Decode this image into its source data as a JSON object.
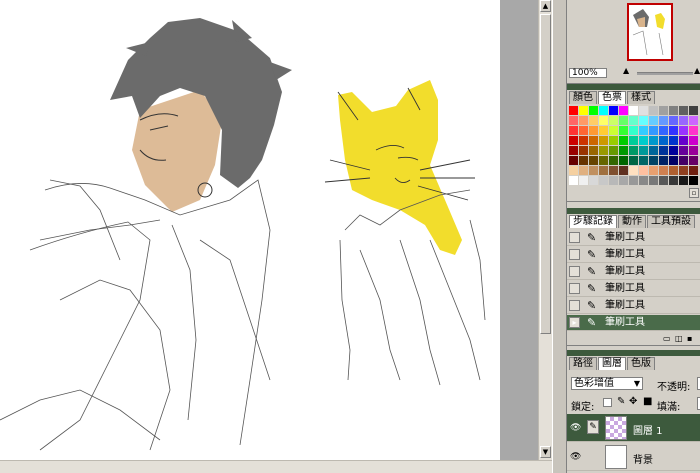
{
  "navigator": {
    "zoom": "100%"
  },
  "swatches_tabs": [
    {
      "label": "顏色",
      "active": false
    },
    {
      "label": "色票",
      "active": true
    },
    {
      "label": "樣式",
      "active": false
    }
  ],
  "history_tabs": [
    {
      "label": "步驟記錄",
      "active": true
    },
    {
      "label": "動作",
      "active": false
    },
    {
      "label": "工具預設",
      "active": false
    }
  ],
  "history": {
    "items": [
      {
        "label": "筆刷工具",
        "icon": "brush-icon",
        "active": false
      },
      {
        "label": "筆刷工具",
        "icon": "brush-icon",
        "active": false
      },
      {
        "label": "筆刷工具",
        "icon": "brush-icon",
        "active": false
      },
      {
        "label": "筆刷工具",
        "icon": "brush-icon",
        "active": false
      },
      {
        "label": "筆刷工具",
        "icon": "brush-icon",
        "active": false
      },
      {
        "label": "筆刷工具",
        "icon": "brush-icon",
        "active": true
      }
    ]
  },
  "layers_tabs": [
    {
      "label": "路徑",
      "active": false
    },
    {
      "label": "圖層",
      "active": true
    },
    {
      "label": "色版",
      "active": false
    }
  ],
  "layers": {
    "blend_mode": "色彩增值",
    "opacity_label": "不透明:",
    "lock_label": "鎖定:",
    "fill_label": "填滿:",
    "items": [
      {
        "name": "圖層 1",
        "active": true
      },
      {
        "name": "背景",
        "active": false
      }
    ]
  },
  "colors": {
    "panel_bg": "#d4d0c8",
    "title_green": "#3d5a3d",
    "active_row": "#4a6b4a",
    "hair_gray": "#6b6b6b",
    "skin": "#d9b48c",
    "cat_yellow": "#f2dd2c"
  },
  "swatch_colors": [
    "#ff0000",
    "#ffff00",
    "#00ff00",
    "#00ffff",
    "#0000ff",
    "#ff00ff",
    "#ffffff",
    "#e0e0e0",
    "#c0c0c0",
    "#a0a0a0",
    "#808080",
    "#606060",
    "#404040",
    "#ff6666",
    "#ff9966",
    "#ffcc66",
    "#ffff66",
    "#ccff66",
    "#66ff66",
    "#66ffcc",
    "#66ffff",
    "#66ccff",
    "#6699ff",
    "#6666ff",
    "#9966ff",
    "#cc66ff",
    "#ff3333",
    "#ff6633",
    "#ff9933",
    "#ffcc33",
    "#ccff33",
    "#33ff33",
    "#33ffcc",
    "#33ccff",
    "#3399ff",
    "#3366ff",
    "#3333ff",
    "#9933ff",
    "#ff33cc",
    "#cc0000",
    "#cc3300",
    "#cc6600",
    "#cc9900",
    "#99cc00",
    "#00cc00",
    "#00cc99",
    "#00cccc",
    "#0099cc",
    "#0066cc",
    "#0033cc",
    "#6600cc",
    "#cc00cc",
    "#990000",
    "#993300",
    "#996600",
    "#999900",
    "#669900",
    "#009900",
    "#009966",
    "#009999",
    "#006699",
    "#003399",
    "#000099",
    "#660099",
    "#990099",
    "#660000",
    "#663300",
    "#664400",
    "#666600",
    "#336600",
    "#006600",
    "#006644",
    "#006666",
    "#004466",
    "#002266",
    "#000066",
    "#440066",
    "#660066",
    "#f5d0a0",
    "#e0b080",
    "#c09060",
    "#a07040",
    "#805030",
    "#603020",
    "#ffe0c0",
    "#ffc0a0",
    "#e8a070",
    "#d08050",
    "#b06030",
    "#904020",
    "#702010",
    "#ffffff",
    "#f0f0f0",
    "#d8d8d8",
    "#c8c8c8",
    "#b8b8b8",
    "#a8a8a8",
    "#989898",
    "#888888",
    "#787878",
    "#585858",
    "#383838",
    "#181818",
    "#000000"
  ]
}
